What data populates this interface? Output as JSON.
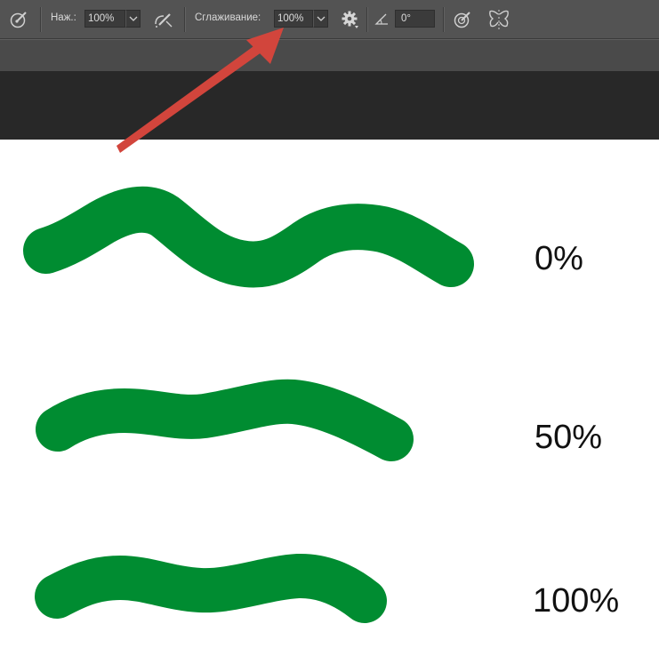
{
  "toolbar": {
    "pressure_label": "Наж.:",
    "pressure_value": "100%",
    "smoothing_label": "Сглаживание:",
    "smoothing_value": "100%",
    "angle_value": "0°"
  },
  "samples": [
    {
      "label": "0%"
    },
    {
      "label": "50%"
    },
    {
      "label": "100%"
    }
  ],
  "colors": {
    "stroke": "#008c31",
    "arrow": "#d2453c",
    "toolbar_bg": "#535353"
  },
  "icons": [
    "brush-pressure-icon",
    "airbrush-icon",
    "gear-icon",
    "angle-icon",
    "pressure-size-icon",
    "symmetry-butterfly-icon"
  ]
}
